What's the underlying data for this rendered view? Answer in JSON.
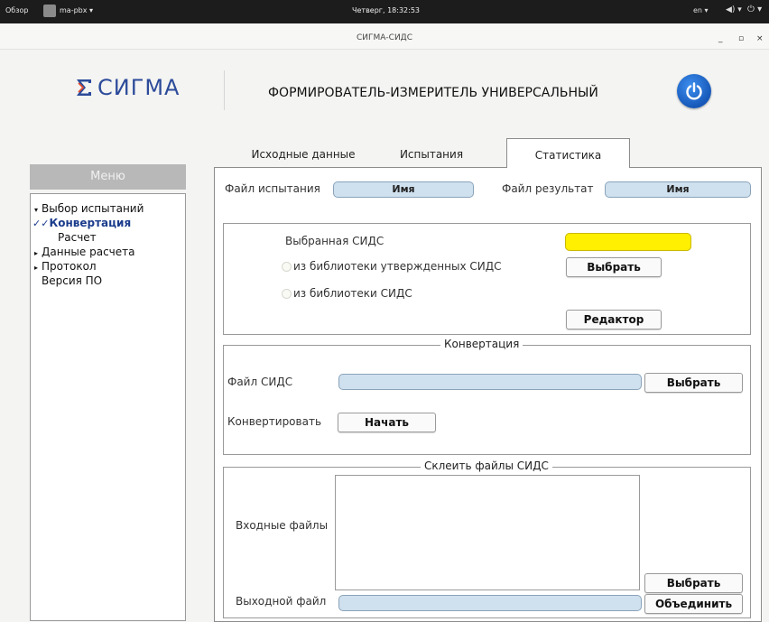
{
  "system_bar": {
    "overview": "Обзор",
    "app_menu": "ma-pbx ▾",
    "clock": "Четверг, 18:32:53",
    "lang": "en ▾",
    "volume": "◀) ▾",
    "power": "⏻ ▾"
  },
  "window": {
    "title": "СИГМА-СИДС",
    "minimize": "_",
    "maximize": "▫",
    "close": "×"
  },
  "header": {
    "logo_text": "СИГМА",
    "title": "ФОРМИРОВАТЕЛЬ-ИЗМЕРИТЕЛЬ УНИВЕРСАЛЬНЫЙ"
  },
  "sidebar": {
    "header": "Меню",
    "items": [
      {
        "label": "Выбор испытаний",
        "marker": "▾"
      },
      {
        "label": "Конвертация",
        "marker": "✓✓"
      },
      {
        "label": "Расчет",
        "marker": ""
      },
      {
        "label": "Данные расчета",
        "marker": "▸"
      },
      {
        "label": "Протокол",
        "marker": "▸"
      },
      {
        "label": "Версия ПО",
        "marker": ""
      }
    ]
  },
  "tabs": [
    {
      "label": "Исходные данные"
    },
    {
      "label": "Испытания"
    },
    {
      "label": "Статистика"
    }
  ],
  "top_row": {
    "test_file_label": "Файл испытания",
    "test_file_value": "Имя",
    "result_file_label": "Файл результат",
    "result_file_value": "Имя"
  },
  "sids_group": {
    "selected_label": "Выбранная СИДС",
    "option_approved": "из библиотеки утвержденных СИДС",
    "option_library": "из библиотеки СИДС",
    "select_button": "Выбрать",
    "editor_button": "Редактор",
    "selected_color": "#ffef00"
  },
  "conversion_group": {
    "title": "Конвертация",
    "file_label": "Файл СИДС",
    "select_button": "Выбрать",
    "convert_label": "Конвертировать",
    "start_button": "Начать"
  },
  "merge_group": {
    "title": "Склеить файлы СИДС",
    "input_label": "Входные файлы",
    "select_button": "Выбрать",
    "output_label": "Выходной файл",
    "merge_button": "Объединить"
  }
}
